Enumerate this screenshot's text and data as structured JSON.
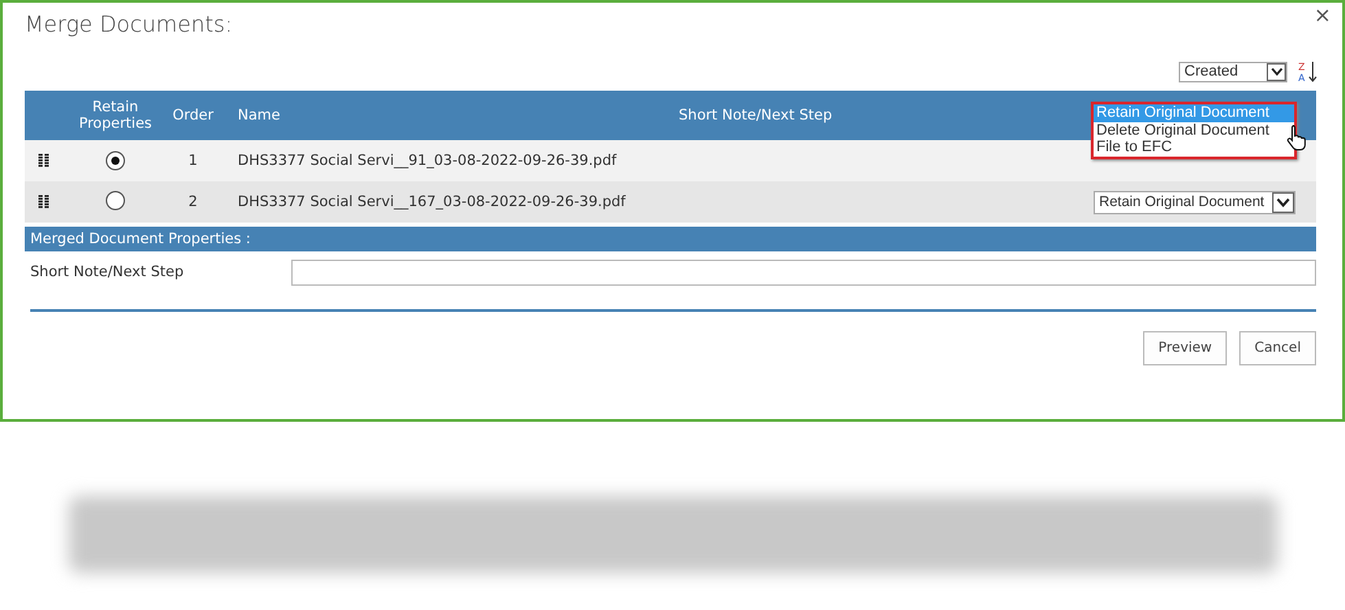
{
  "dialog": {
    "title": "Merge Documents:",
    "close": "×"
  },
  "sort": {
    "value": "Created",
    "icon_top": "Z",
    "icon_bottom": "A"
  },
  "columns": {
    "retain": "Retain Properties",
    "order": "Order",
    "name": "Name",
    "note": "Short Note/Next Step"
  },
  "rows": [
    {
      "order": "1",
      "name": "DHS3377 Social Servi__91_03-08-2022-09-26-39.pdf",
      "selected": true
    },
    {
      "order": "2",
      "name": "DHS3377 Social Servi__167_03-08-2022-09-26-39.pdf",
      "selected": false,
      "action": "Retain Original Document"
    }
  ],
  "open_dropdown": {
    "options": [
      {
        "label": "Retain Original Document",
        "selected": true
      },
      {
        "label": "Delete Original Document",
        "selected": false
      },
      {
        "label": "File to EFC",
        "selected": false
      }
    ]
  },
  "merged": {
    "title": "Merged Document Properties :",
    "field_label": "Short Note/Next Step"
  },
  "buttons": [
    "Preview",
    "Cancel"
  ]
}
